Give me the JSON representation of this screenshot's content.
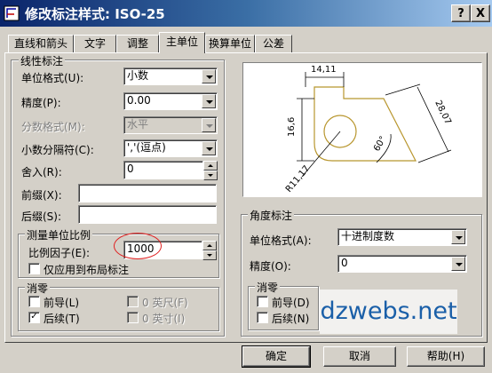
{
  "window": {
    "title": "修改标注样式: ISO-25",
    "help_btn": "?",
    "close_btn": "X"
  },
  "tabs": [
    {
      "label": "直线和箭头",
      "active": false
    },
    {
      "label": "文字",
      "active": false
    },
    {
      "label": "调整",
      "active": false
    },
    {
      "label": "主单位",
      "active": true
    },
    {
      "label": "换算单位",
      "active": false
    },
    {
      "label": "公差",
      "active": false
    }
  ],
  "linear": {
    "group_label": "线性标注",
    "unit_format": {
      "label": "单位格式(U):",
      "value": "小数"
    },
    "precision": {
      "label": "精度(P):",
      "value": "0.00"
    },
    "fraction_format": {
      "label": "分数格式(M):",
      "value": "水平"
    },
    "decimal_sep": {
      "label": "小数分隔符(C):",
      "value": "','(逗点)"
    },
    "round_off": {
      "label": "舍入(R):",
      "value": "0"
    },
    "prefix": {
      "label": "前缀(X):",
      "value": ""
    },
    "suffix": {
      "label": "后缀(S):",
      "value": ""
    },
    "scale": {
      "group_label": "测量单位比例",
      "factor_label": "比例因子(E):",
      "factor_value": "1000",
      "layout_only_label": "仅应用到布局标注",
      "layout_only_checked": false
    },
    "zero": {
      "group_label": "消零",
      "leading": {
        "label": "前导(L)",
        "checked": false
      },
      "trailing": {
        "label": "后续(T)",
        "checked": true
      },
      "feet": {
        "label": "0 英尺(F)",
        "checked": false
      },
      "inches": {
        "label": "0 英寸(I)",
        "checked": false
      }
    }
  },
  "preview": {
    "dim_top": "14,11",
    "dim_left": "16,6",
    "dim_right": "28,07",
    "dim_angle": "60°",
    "dim_radius": "R11,17"
  },
  "angular": {
    "group_label": "角度标注",
    "unit_format": {
      "label": "单位格式(A):",
      "value": "十进制度数"
    },
    "precision": {
      "label": "精度(O):",
      "value": "0"
    },
    "zero": {
      "group_label": "消零",
      "leading": {
        "label": "前导(D)",
        "checked": false
      },
      "trailing": {
        "label": "后续(N)",
        "checked": false
      }
    }
  },
  "watermark": "dzwebs.net",
  "buttons": {
    "ok": "确定",
    "cancel": "取消",
    "help": "帮助(H)"
  },
  "colors": {
    "title_start": "#0a246a",
    "title_end": "#a6caf0",
    "face": "#d4d0c8",
    "preview_lines": "#b8962e",
    "annotation": "#e02020",
    "watermark": "#1a5fa8"
  }
}
